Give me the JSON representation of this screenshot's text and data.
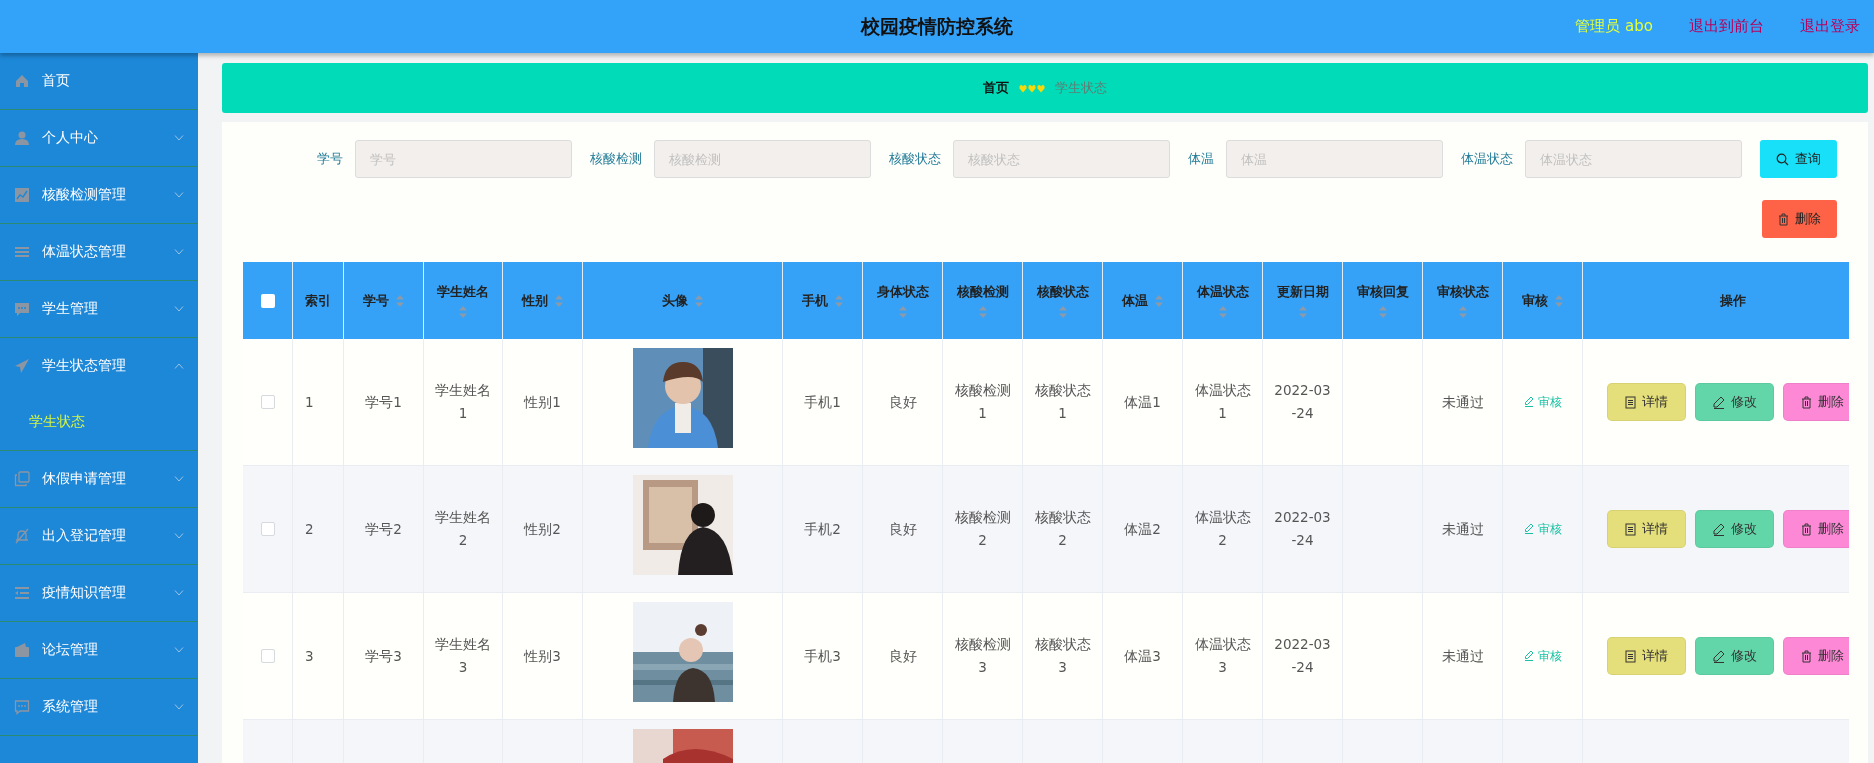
{
  "header": {
    "title": "校园疫情防控系统",
    "user": "管理员 abo",
    "links": [
      "退出到前台",
      "退出登录"
    ]
  },
  "sidebar": {
    "items": [
      {
        "kind": "link",
        "label": "首页"
      },
      {
        "kind": "menu",
        "label": "个人中心",
        "expanded": false
      },
      {
        "kind": "menu",
        "label": "核酸检测管理",
        "expanded": false
      },
      {
        "kind": "menu",
        "label": "体温状态管理",
        "expanded": false
      },
      {
        "kind": "menu",
        "label": "学生管理",
        "expanded": false
      },
      {
        "kind": "menu",
        "label": "学生状态管理",
        "expanded": true,
        "children": [
          {
            "label": "学生状态",
            "selected": true
          }
        ]
      },
      {
        "kind": "menu",
        "label": "休假申请管理",
        "expanded": false
      },
      {
        "kind": "menu",
        "label": "出入登记管理",
        "expanded": false
      },
      {
        "kind": "menu",
        "label": "疫情知识管理",
        "expanded": false
      },
      {
        "kind": "menu",
        "label": "论坛管理",
        "expanded": false
      },
      {
        "kind": "menu",
        "label": "系统管理",
        "expanded": false
      }
    ]
  },
  "breadcrumb": [
    {
      "label": "首页",
      "selected": false
    },
    {
      "label": "学生状态",
      "selected": true
    }
  ],
  "search": {
    "fields": [
      {
        "label": "学号",
        "placeholder": "学号"
      },
      {
        "label": "核酸检测",
        "placeholder": "核酸检测"
      },
      {
        "label": "核酸状态",
        "placeholder": "核酸状态"
      },
      {
        "label": "体温",
        "placeholder": "体温"
      },
      {
        "label": "体温状态",
        "placeholder": "体温状态"
      }
    ],
    "buttons": [
      {
        "kind": "search",
        "label": "查询"
      },
      {
        "kind": "delete",
        "label": "删除"
      }
    ]
  },
  "table": {
    "select_all": {
      "checked": false
    },
    "columns": [
      {
        "label": "索引",
        "sortable": false
      },
      {
        "label": "学号",
        "sortable": true
      },
      {
        "label": "学生姓名",
        "sortable": true
      },
      {
        "label": "性别",
        "sortable": true
      },
      {
        "label": "头像",
        "sortable": true
      },
      {
        "label": "手机",
        "sortable": true
      },
      {
        "label": "身体状态",
        "sortable": true
      },
      {
        "label": "核酸检测",
        "sortable": true
      },
      {
        "label": "核酸状态",
        "sortable": true
      },
      {
        "label": "体温",
        "sortable": true
      },
      {
        "label": "体温状态",
        "sortable": true
      },
      {
        "label": "更新日期",
        "sortable": true
      },
      {
        "label": "审核回复",
        "sortable": true
      },
      {
        "label": "审核状态",
        "sortable": true
      },
      {
        "label": "审核",
        "sortable": true
      },
      {
        "label": "操作",
        "sortable": false
      }
    ],
    "rows": [
      {
        "checked": false,
        "index": "1",
        "student_no": "学号1",
        "name": "学生姓名1",
        "gender": "性别1",
        "avatar": {
          "kind": "picture"
        },
        "phone": "手机1",
        "health": "良好",
        "nucleic_test": "核酸检测1",
        "nucleic_status": "核酸状态1",
        "temperature": "体温1",
        "temp_status": "体温状态1",
        "updated": "2022-03-24",
        "review_status": "未通过",
        "review": "审核",
        "actions": [
          {
            "kind": "detail",
            "label": "详情"
          },
          {
            "kind": "edit",
            "label": "修改"
          },
          {
            "kind": "delete",
            "label": "删除"
          }
        ]
      },
      {
        "checked": false,
        "index": "2",
        "student_no": "学号2",
        "name": "学生姓名2",
        "gender": "性别2",
        "avatar": {
          "kind": "picture"
        },
        "phone": "手机2",
        "health": "良好",
        "nucleic_test": "核酸检测2",
        "nucleic_status": "核酸状态2",
        "temperature": "体温2",
        "temp_status": "体温状态2",
        "updated": "2022-03-24",
        "review_status": "未通过",
        "review": "审核",
        "actions": [
          {
            "kind": "detail",
            "label": "详情"
          },
          {
            "kind": "edit",
            "label": "修改"
          },
          {
            "kind": "delete",
            "label": "删除"
          }
        ]
      },
      {
        "checked": false,
        "index": "3",
        "student_no": "学号3",
        "name": "学生姓名3",
        "gender": "性别3",
        "avatar": {
          "kind": "picture"
        },
        "phone": "手机3",
        "health": "良好",
        "nucleic_test": "核酸检测3",
        "nucleic_status": "核酸状态3",
        "temperature": "体温3",
        "temp_status": "体温状态3",
        "updated": "2022-03-24",
        "review_status": "未通过",
        "review": "审核",
        "actions": [
          {
            "kind": "detail",
            "label": "详情"
          },
          {
            "kind": "edit",
            "label": "修改"
          },
          {
            "kind": "delete",
            "label": "删除"
          }
        ]
      },
      {
        "avatar": {
          "kind": "picture"
        }
      }
    ]
  }
}
